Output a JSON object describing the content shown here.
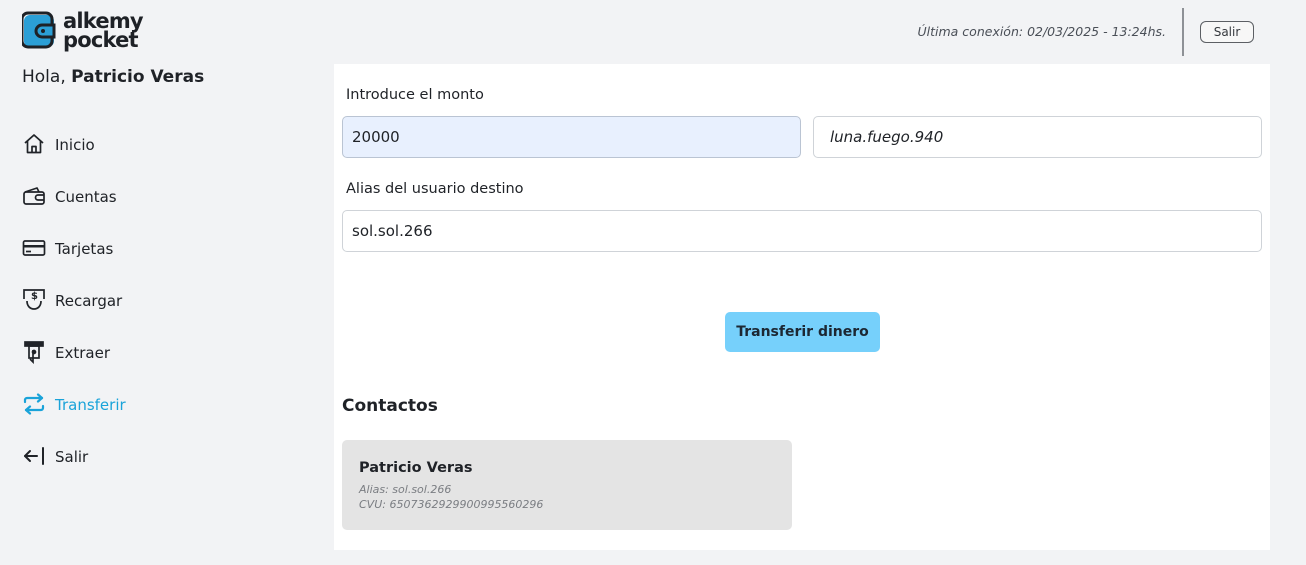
{
  "app": {
    "logo_line1": "alkemy",
    "logo_line2": "pocket"
  },
  "header": {
    "last_connection": "Última conexión: 02/03/2025 - 13:24hs.",
    "logout_label": "Salir"
  },
  "user": {
    "greeting_prefix": "Hola,",
    "name": "Patricio Veras"
  },
  "sidebar": {
    "items": [
      {
        "label": "Inicio",
        "icon": "home-icon",
        "active": false
      },
      {
        "label": "Cuentas",
        "icon": "wallet-icon",
        "active": false
      },
      {
        "label": "Tarjetas",
        "icon": "credit-card-icon",
        "active": false
      },
      {
        "label": "Recargar",
        "icon": "recharge-icon",
        "active": false
      },
      {
        "label": "Extraer",
        "icon": "atm-withdraw-icon",
        "active": false
      },
      {
        "label": "Transferir",
        "icon": "transfer-arrows-icon",
        "active": true
      },
      {
        "label": "Salir",
        "icon": "logout-arrow-icon",
        "active": false
      }
    ]
  },
  "form": {
    "amount_label": "Introduce el monto",
    "amount_value": "20000",
    "source_alias_value": "luna.fuego.940",
    "dest_alias_label": "Alias del usuario destino",
    "dest_alias_value": "sol.sol.266",
    "submit_label": "Transferir dinero"
  },
  "contacts": {
    "title": "Contactos",
    "items": [
      {
        "name": "Patricio Veras",
        "alias": "Alias: sol.sol.266",
        "cvu": "CVU: 6507362929900995560296"
      }
    ]
  },
  "colors": {
    "accent": "#1aa3d9",
    "button": "#76d0fb",
    "panel": "#ffffff",
    "background": "#f2f3f5"
  }
}
